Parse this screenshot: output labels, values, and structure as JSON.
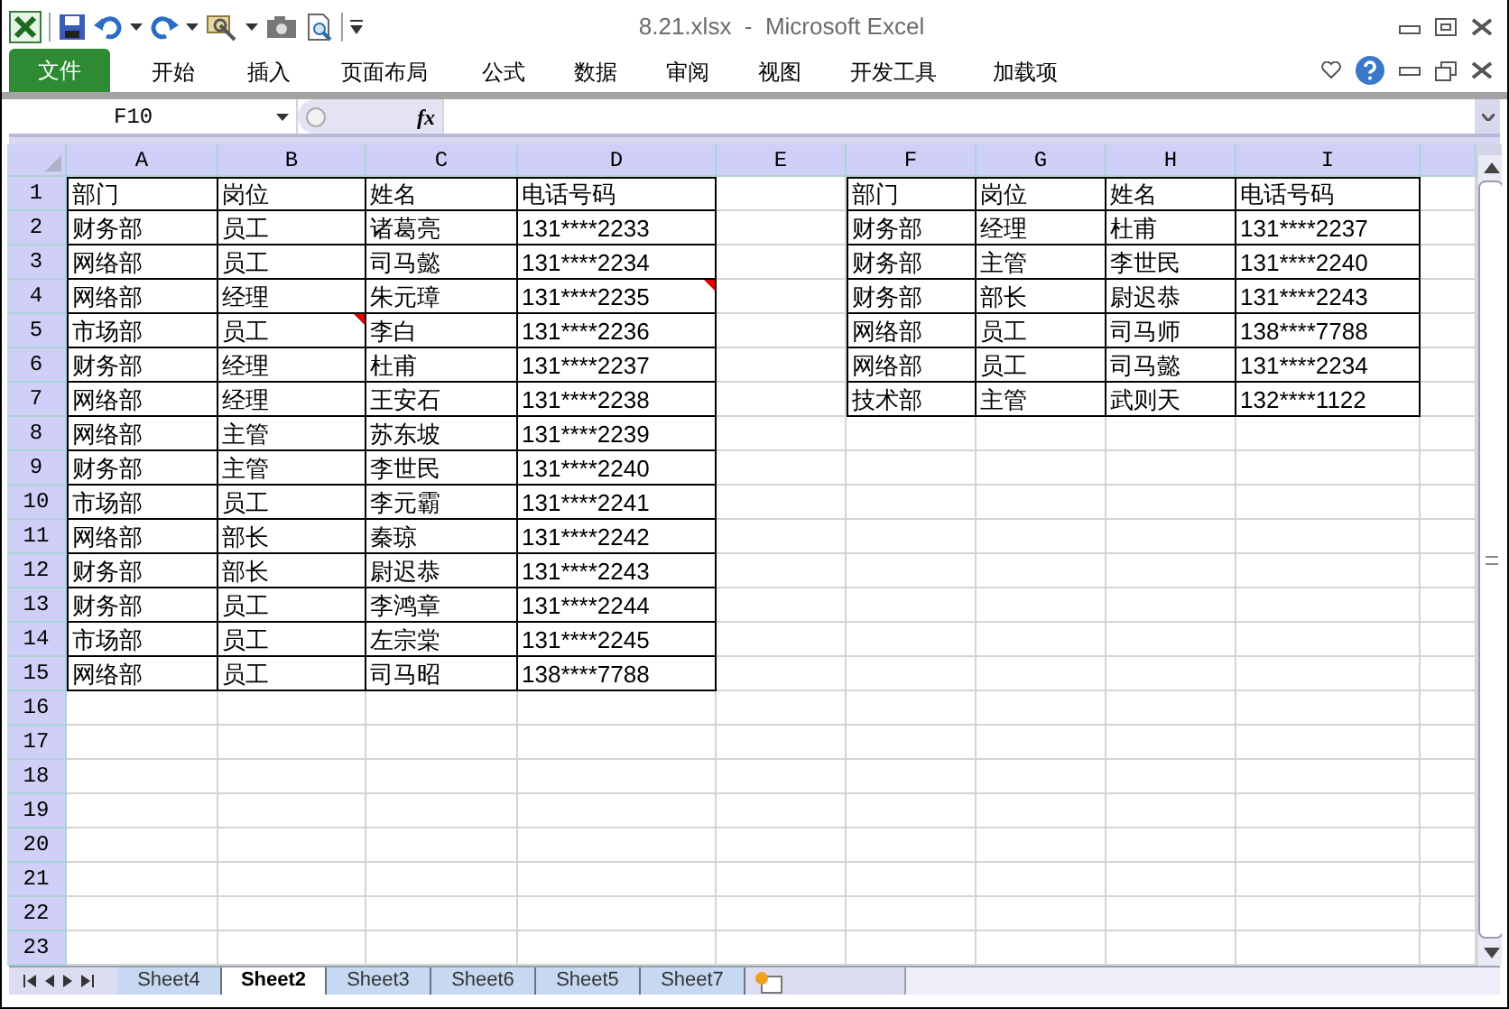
{
  "window": {
    "title": "8.21.xlsx  -  Microsoft Excel"
  },
  "ribbon_tabs": [
    {
      "label": "文件",
      "kind": "file"
    },
    {
      "label": "开始",
      "kind": "tab"
    },
    {
      "label": "插入",
      "kind": "tab"
    },
    {
      "label": "页面布局",
      "kind": "tab"
    },
    {
      "label": "公式",
      "kind": "tab"
    },
    {
      "label": "数据",
      "kind": "tab"
    },
    {
      "label": "审阅",
      "kind": "tab"
    },
    {
      "label": "视图",
      "kind": "tab"
    },
    {
      "label": "开发工具",
      "kind": "tab"
    },
    {
      "label": "加载项",
      "kind": "tab"
    }
  ],
  "formula_bar": {
    "name_box": "F10",
    "fx": "fx"
  },
  "columns": [
    "A",
    "B",
    "C",
    "D",
    "E",
    "F",
    "G",
    "H",
    "I"
  ],
  "row_numbers": [
    "1",
    "2",
    "3",
    "4",
    "5",
    "6",
    "7",
    "8",
    "9",
    "10",
    "11",
    "12",
    "13",
    "14",
    "15",
    "16",
    "17",
    "18",
    "19",
    "20",
    "21",
    "22",
    "23"
  ],
  "left_table": [
    [
      {
        "text": "部门",
        "comment": false
      },
      {
        "text": "岗位",
        "comment": false
      },
      {
        "text": "姓名",
        "comment": false
      },
      {
        "text": "电话号码",
        "comment": false
      }
    ],
    [
      {
        "text": "财务部",
        "comment": false
      },
      {
        "text": "员工",
        "comment": false
      },
      {
        "text": "诸葛亮",
        "comment": false
      },
      {
        "text": "131****2233",
        "comment": false
      }
    ],
    [
      {
        "text": "网络部",
        "comment": false
      },
      {
        "text": "员工",
        "comment": false
      },
      {
        "text": "司马懿",
        "comment": false
      },
      {
        "text": "131****2234",
        "comment": false
      }
    ],
    [
      {
        "text": "网络部",
        "comment": false
      },
      {
        "text": "经理",
        "comment": false
      },
      {
        "text": "朱元璋",
        "comment": false
      },
      {
        "text": "131****2235",
        "comment": true
      }
    ],
    [
      {
        "text": "市场部",
        "comment": false
      },
      {
        "text": "员工",
        "comment": true
      },
      {
        "text": "李白",
        "comment": false
      },
      {
        "text": "131****2236",
        "comment": false
      }
    ],
    [
      {
        "text": "财务部",
        "comment": false
      },
      {
        "text": "经理",
        "comment": false
      },
      {
        "text": "杜甫",
        "comment": false
      },
      {
        "text": "131****2237",
        "comment": false
      }
    ],
    [
      {
        "text": "网络部",
        "comment": false
      },
      {
        "text": "经理",
        "comment": false
      },
      {
        "text": "王安石",
        "comment": false
      },
      {
        "text": "131****2238",
        "comment": false
      }
    ],
    [
      {
        "text": "网络部",
        "comment": false
      },
      {
        "text": "主管",
        "comment": false
      },
      {
        "text": "苏东坡",
        "comment": false
      },
      {
        "text": "131****2239",
        "comment": false
      }
    ],
    [
      {
        "text": "财务部",
        "comment": false
      },
      {
        "text": "主管",
        "comment": false
      },
      {
        "text": "李世民",
        "comment": false
      },
      {
        "text": "131****2240",
        "comment": false
      }
    ],
    [
      {
        "text": "市场部",
        "comment": false
      },
      {
        "text": "员工",
        "comment": false
      },
      {
        "text": "李元霸",
        "comment": false
      },
      {
        "text": "131****2241",
        "comment": false
      }
    ],
    [
      {
        "text": "网络部",
        "comment": false
      },
      {
        "text": "部长",
        "comment": false
      },
      {
        "text": "秦琼",
        "comment": false
      },
      {
        "text": "131****2242",
        "comment": false
      }
    ],
    [
      {
        "text": "财务部",
        "comment": false
      },
      {
        "text": "部长",
        "comment": false
      },
      {
        "text": "尉迟恭",
        "comment": false
      },
      {
        "text": "131****2243",
        "comment": false
      }
    ],
    [
      {
        "text": "财务部",
        "comment": false
      },
      {
        "text": "员工",
        "comment": false
      },
      {
        "text": "李鸿章",
        "comment": false
      },
      {
        "text": "131****2244",
        "comment": false
      }
    ],
    [
      {
        "text": "市场部",
        "comment": false
      },
      {
        "text": "员工",
        "comment": false
      },
      {
        "text": "左宗棠",
        "comment": false
      },
      {
        "text": "131****2245",
        "comment": false
      }
    ],
    [
      {
        "text": "网络部",
        "comment": false
      },
      {
        "text": "员工",
        "comment": false
      },
      {
        "text": "司马昭",
        "comment": false
      },
      {
        "text": "138****7788",
        "comment": false
      }
    ]
  ],
  "right_table": [
    [
      {
        "text": "部门",
        "comment": false
      },
      {
        "text": "岗位",
        "comment": false
      },
      {
        "text": "姓名",
        "comment": false
      },
      {
        "text": "电话号码",
        "comment": false
      }
    ],
    [
      {
        "text": "财务部",
        "comment": false
      },
      {
        "text": "经理",
        "comment": false
      },
      {
        "text": "杜甫",
        "comment": false
      },
      {
        "text": "131****2237",
        "comment": false
      }
    ],
    [
      {
        "text": "财务部",
        "comment": false
      },
      {
        "text": "主管",
        "comment": false
      },
      {
        "text": "李世民",
        "comment": false
      },
      {
        "text": "131****2240",
        "comment": false
      }
    ],
    [
      {
        "text": "财务部",
        "comment": false
      },
      {
        "text": "部长",
        "comment": false
      },
      {
        "text": "尉迟恭",
        "comment": false
      },
      {
        "text": "131****2243",
        "comment": false
      }
    ],
    [
      {
        "text": "网络部",
        "comment": false
      },
      {
        "text": "员工",
        "comment": false
      },
      {
        "text": "司马师",
        "comment": false
      },
      {
        "text": "138****7788",
        "comment": false
      }
    ],
    [
      {
        "text": "网络部",
        "comment": false
      },
      {
        "text": "员工",
        "comment": false
      },
      {
        "text": "司马懿",
        "comment": false
      },
      {
        "text": "131****2234",
        "comment": false
      }
    ],
    [
      {
        "text": "技术部",
        "comment": false
      },
      {
        "text": "主管",
        "comment": false
      },
      {
        "text": "武则天",
        "comment": false
      },
      {
        "text": "132****1122",
        "comment": false
      }
    ]
  ],
  "sheet_tabs": [
    {
      "label": "Sheet4",
      "selected": false
    },
    {
      "label": "Sheet2",
      "selected": true
    },
    {
      "label": "Sheet3",
      "selected": false
    },
    {
      "label": "Sheet6",
      "selected": false
    },
    {
      "label": "Sheet5",
      "selected": false
    },
    {
      "label": "Sheet7",
      "selected": false
    }
  ]
}
